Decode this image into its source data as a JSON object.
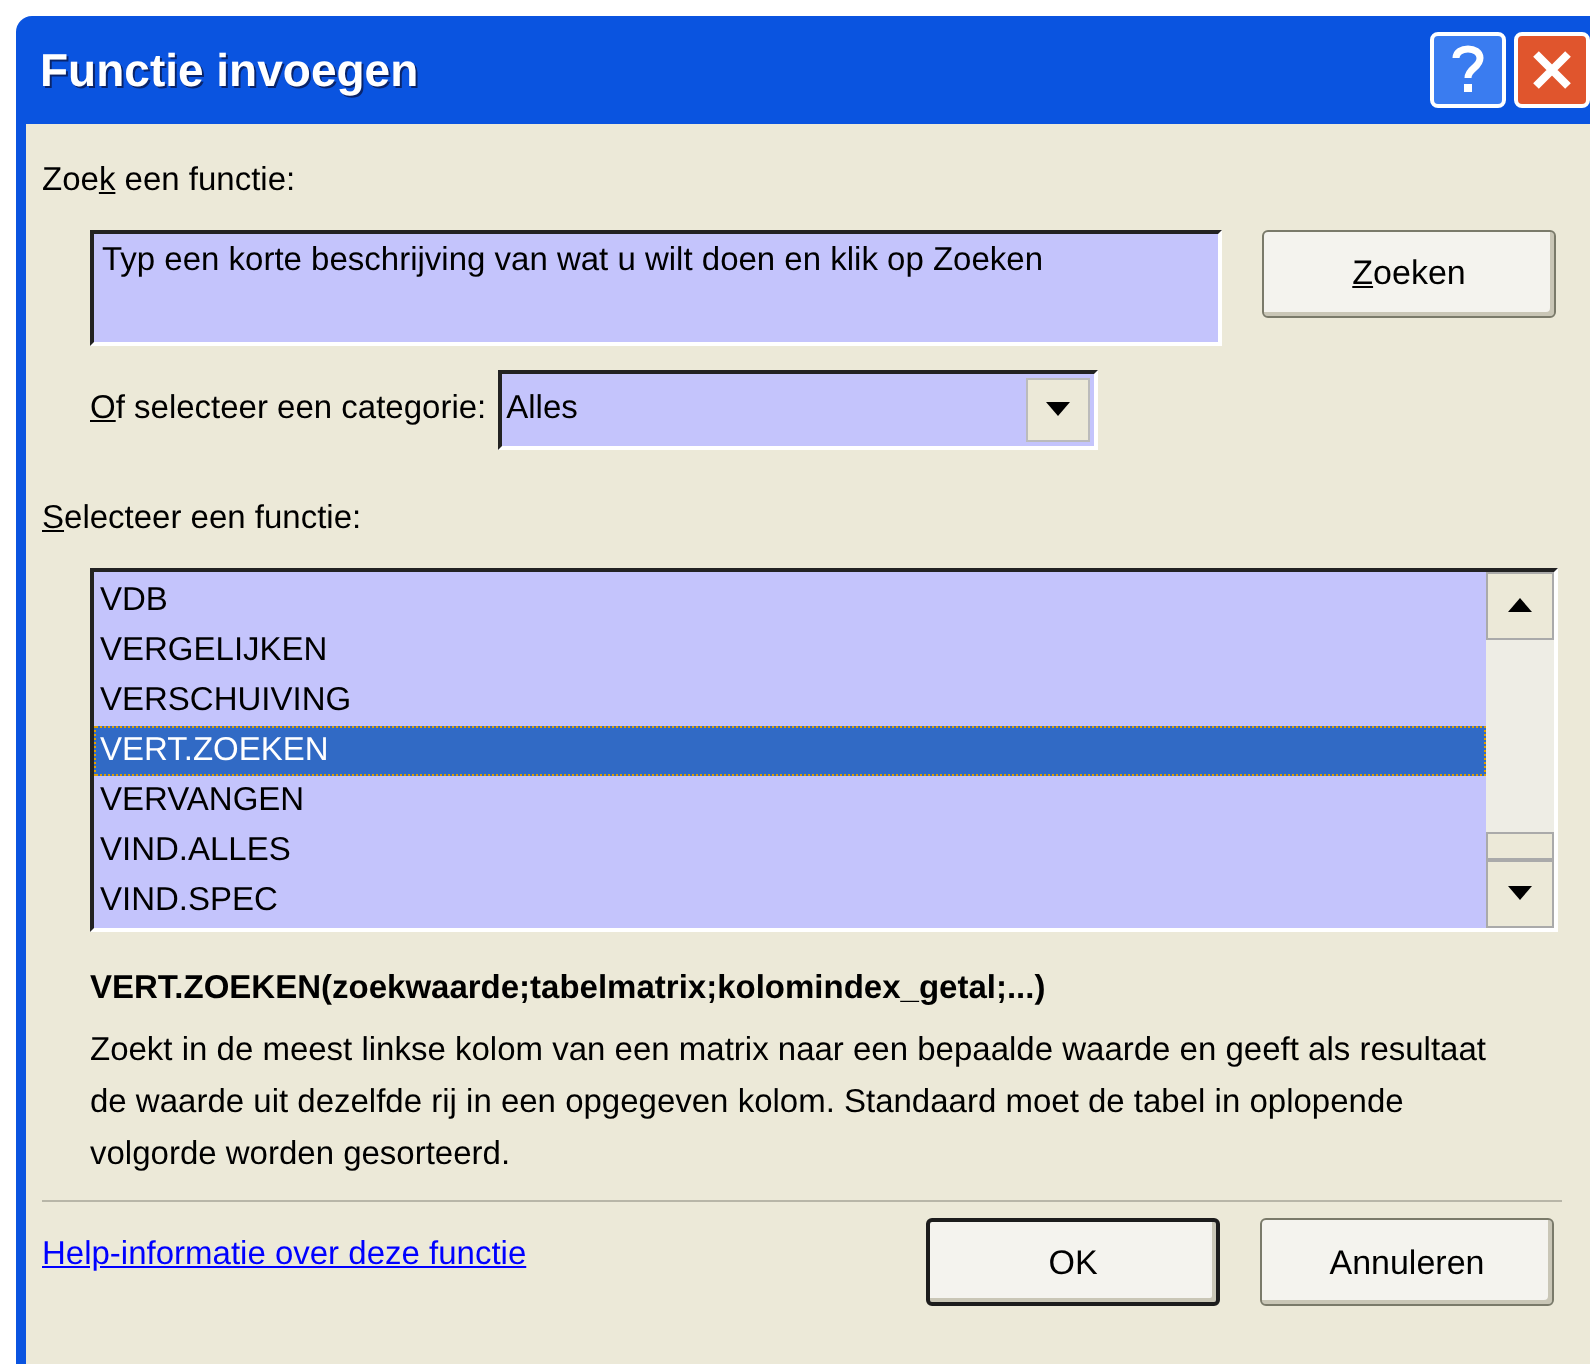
{
  "window": {
    "title": "Functie invoegen"
  },
  "search": {
    "label_parts": {
      "before": "Zoe",
      "key": "k",
      "after": " een functie:"
    },
    "value": "Typ een korte beschrijving van wat u wilt doen en klik op Zoeken",
    "button_parts": {
      "key": "Z",
      "after": "oeken"
    }
  },
  "category": {
    "label_parts": {
      "key": "O",
      "after": "f selecteer een categorie:"
    },
    "value": "Alles"
  },
  "functions": {
    "label_parts": {
      "key": "S",
      "after": "electeer een functie:"
    },
    "items": [
      {
        "name": "VDB",
        "selected": false
      },
      {
        "name": "VERGELIJKEN",
        "selected": false
      },
      {
        "name": "VERSCHUIVING",
        "selected": false
      },
      {
        "name": "VERT.ZOEKEN",
        "selected": true
      },
      {
        "name": "VERVANGEN",
        "selected": false
      },
      {
        "name": "VIND.ALLES",
        "selected": false
      },
      {
        "name": "VIND.SPEC",
        "selected": false
      }
    ]
  },
  "signature": "VERT.ZOEKEN(zoekwaarde;tabelmatrix;kolomindex_getal;...)",
  "description": "Zoekt in de meest linkse kolom van een matrix naar een bepaalde waarde en geeft als resultaat de waarde uit dezelfde rij in een opgegeven kolom. Standaard moet de tabel in oplopende volgorde worden gesorteerd.",
  "help_link": "Help-informatie over deze functie",
  "buttons": [
    {
      "label": "OK",
      "default": true
    },
    {
      "label": "Annuleren",
      "default": false
    }
  ]
}
